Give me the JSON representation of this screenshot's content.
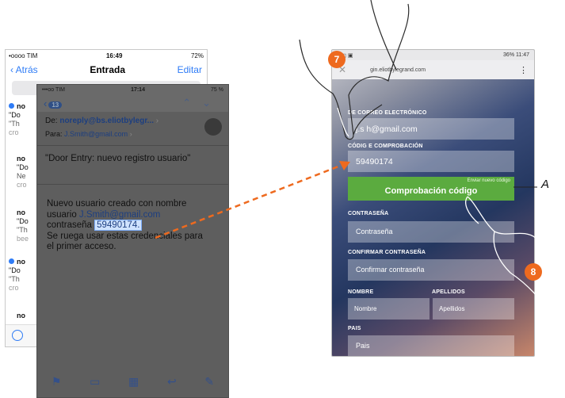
{
  "back_phone": {
    "status": {
      "carrier": "•oooo TIM",
      "time": "16:49",
      "battery": "72%"
    },
    "nav": {
      "back": "Atrás",
      "title": "Entrada",
      "edit": "Editar"
    },
    "items": [
      {
        "sender": "no",
        "l1": "\"Do",
        "l2": "\"Th",
        "l3": "cro",
        "unread": true
      },
      {
        "sender": "no",
        "l1": "\"Do",
        "l2": "Ne",
        "l3": "cro",
        "unread": false
      },
      {
        "sender": "no",
        "l1": "\"Do",
        "l2": "\"Th",
        "l3": "bee",
        "unread": false
      },
      {
        "sender": "no",
        "l1": "\"Do",
        "l2": "\"Th",
        "l3": "cro",
        "unread": true
      },
      {
        "sender": "no",
        "l1": "",
        "l2": "",
        "l3": "",
        "unread": false
      }
    ]
  },
  "front_phone": {
    "status": {
      "carrier": "•••oo TIM",
      "time": "17:14",
      "battery": "75 %"
    },
    "nav": {
      "badge": "13"
    },
    "from_label": "De:",
    "from": "noreply@bs.eliotbylegr...",
    "to_label": "Para:",
    "to": "J.Smith@gmail.com",
    "subject": "\"Door Entry: nuevo registro usuario\"",
    "body_1": "Nuevo usuario creado con nombre",
    "body_2": "usuario",
    "body_user": "J.Smith@gmail.com",
    "body_3": "contraseña",
    "body_pass": "59490174.",
    "body_4": "Se ruega usar estas credenciales para",
    "body_5": "el primer acceso."
  },
  "right_phone": {
    "status": {
      "time": "11:47",
      "battery": "36%"
    },
    "url": "gin.eliotbylegrand.com",
    "email_label": "DE CORREO ELECTRÓNICO",
    "email_value": "j.s    h@gmail.com",
    "code_label": "CÓDIG  E COMPROBACIÓN",
    "code_value": "59490174",
    "resend": "Enviar nuevo código",
    "verify_button": "Comprobación código",
    "password_label": "CONTRASEÑA",
    "password_placeholder": "Contraseña",
    "confirm_label": "CONFIRMAR CONTRASEÑA",
    "confirm_placeholder": "Confirmar contraseña",
    "name_label": "NOMBRE",
    "name_placeholder": "Nombre",
    "surname_label": "APELLIDOS",
    "surname_placeholder": "Apellidos",
    "country_label": "PAIS",
    "country_placeholder": "Pais"
  },
  "annotations": {
    "step_7": "7",
    "step_8": "8",
    "callout": "A"
  },
  "colors": {
    "accent_orange": "#ee6a1f",
    "button_green": "#5bab3f",
    "ios_blue": "#2f7cf6"
  }
}
